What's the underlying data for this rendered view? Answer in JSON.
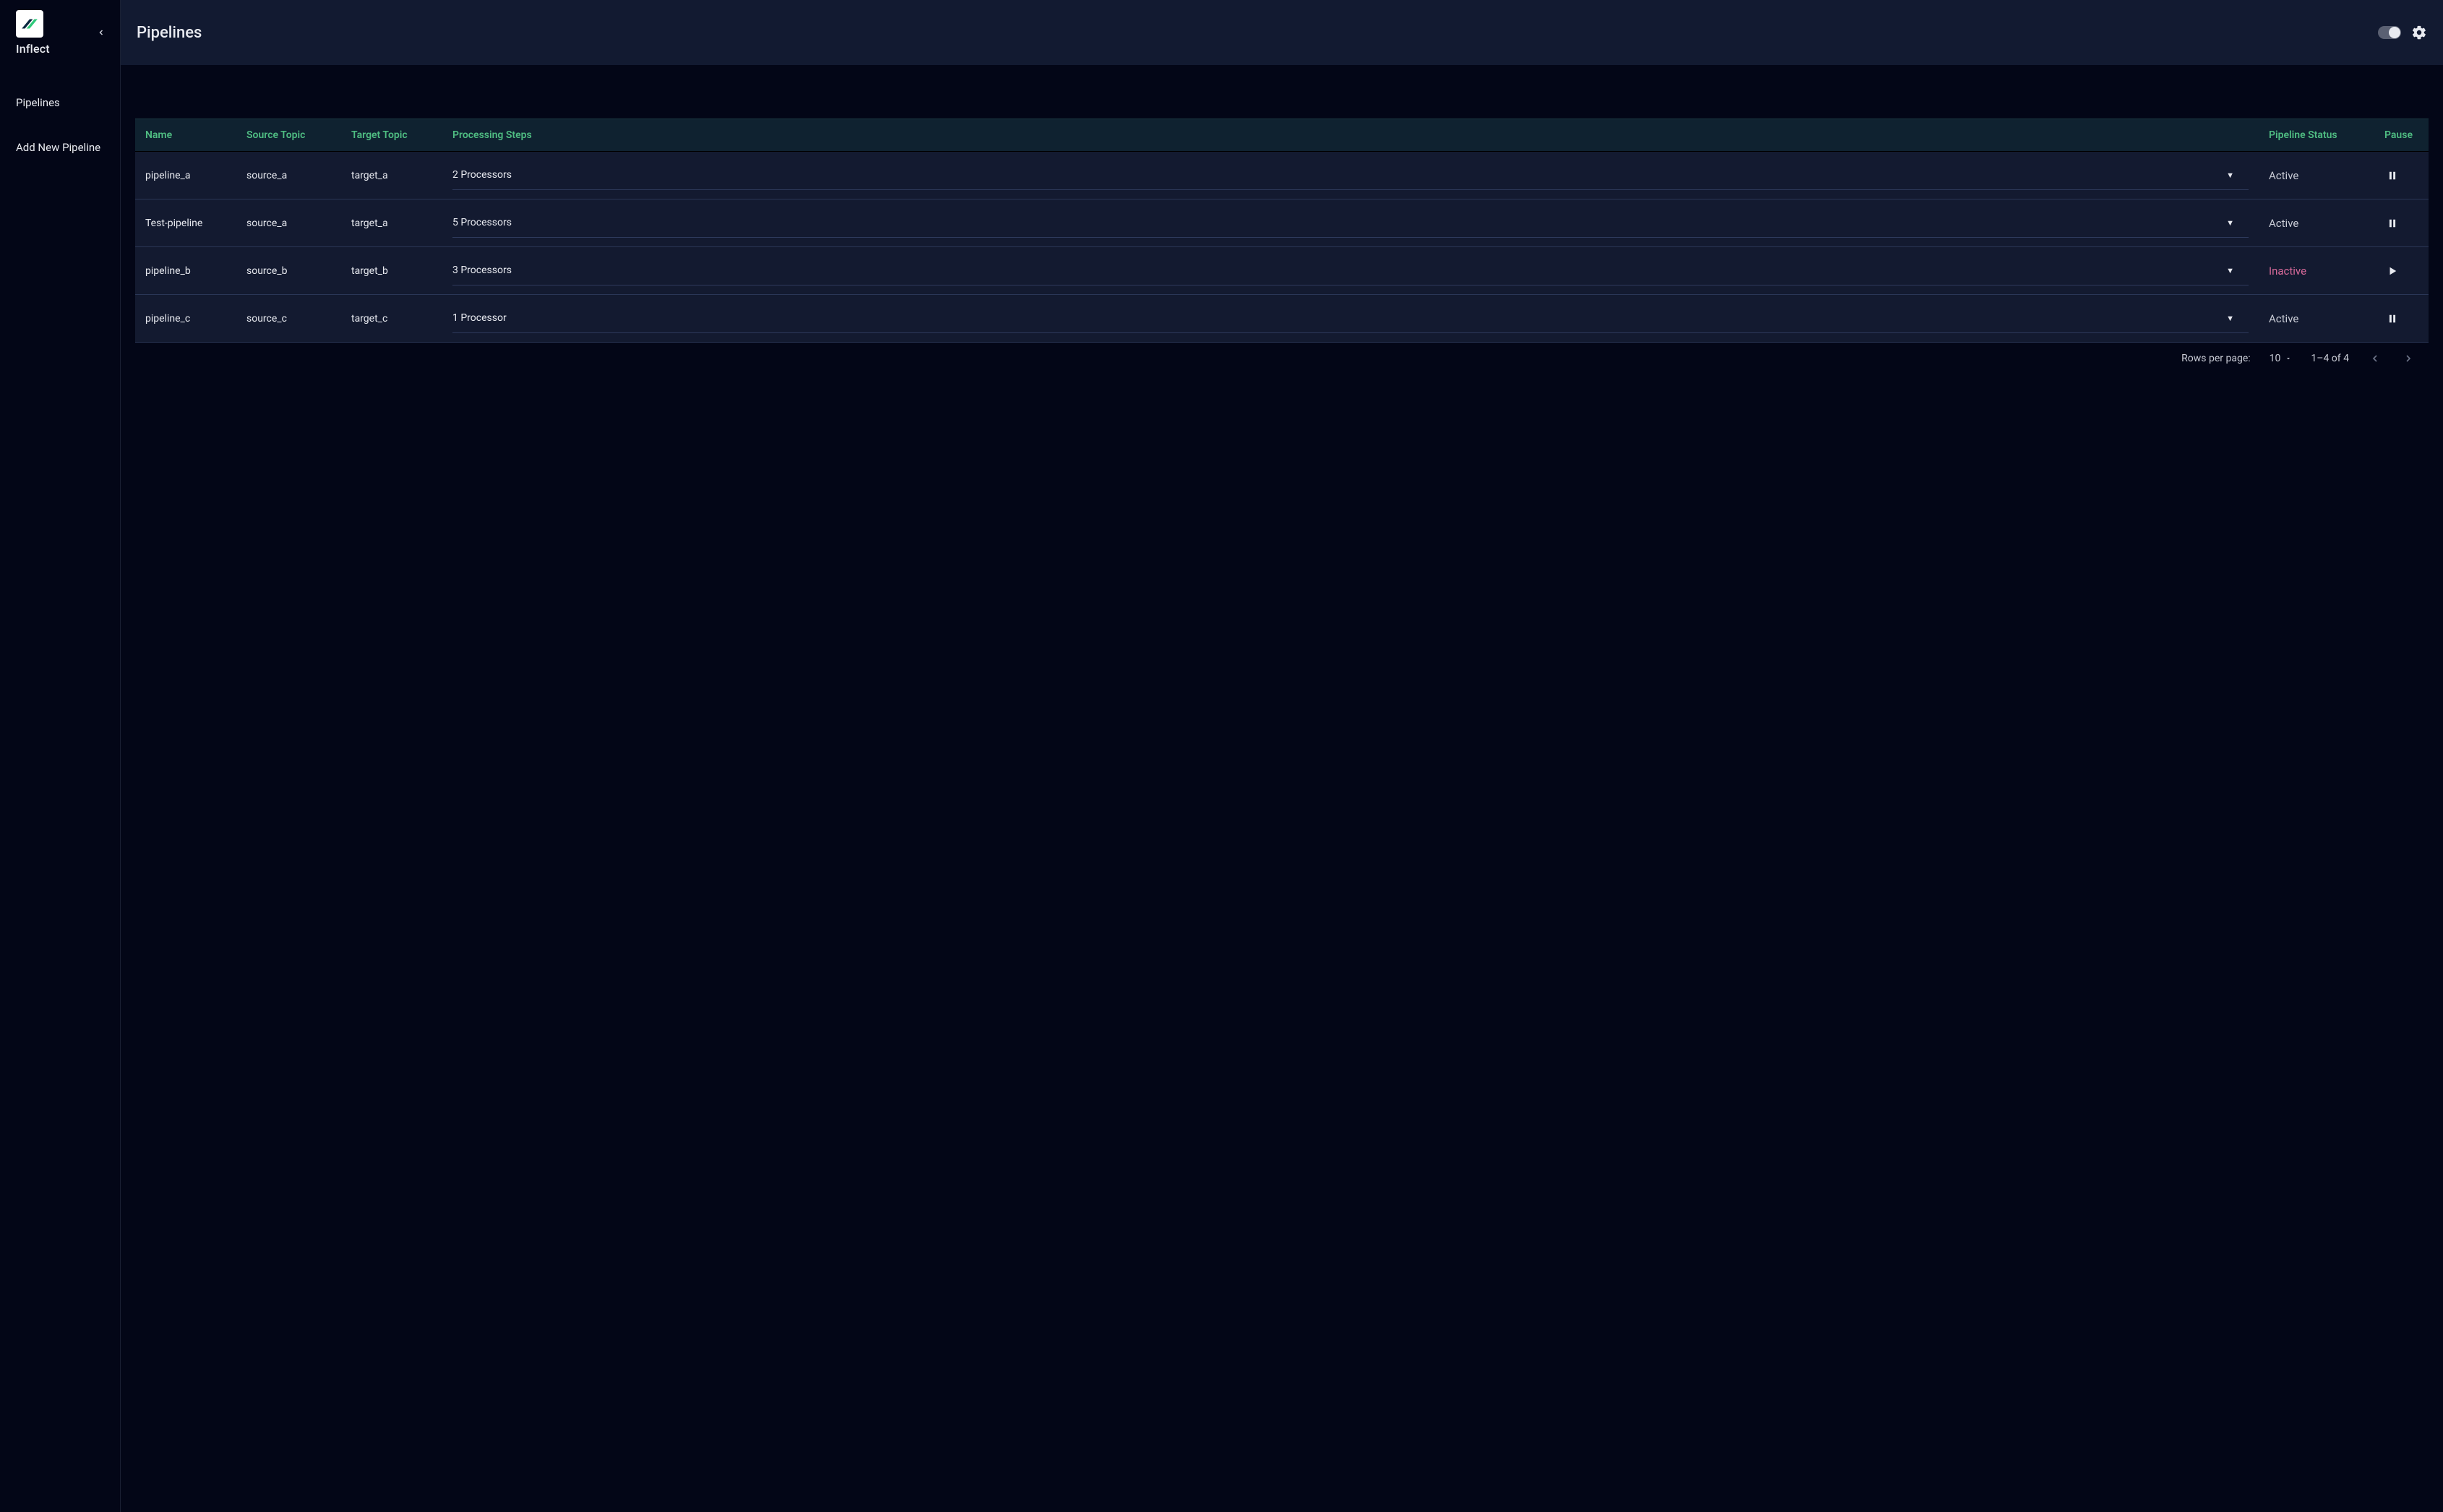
{
  "brand": {
    "name": "Inflect"
  },
  "sidebar": {
    "items": [
      {
        "label": "Pipelines"
      },
      {
        "label": "Add New Pipeline"
      }
    ]
  },
  "header": {
    "title": "Pipelines"
  },
  "table": {
    "columns": {
      "name": "Name",
      "source": "Source Topic",
      "target": "Target Topic",
      "steps": "Processing Steps",
      "status": "Pipeline Status",
      "pause": "Pause"
    },
    "rows": [
      {
        "name": "pipeline_a",
        "source": "source_a",
        "target": "target_a",
        "steps": "2 Processors",
        "status": "Active",
        "action": "pause"
      },
      {
        "name": "Test-pipeline",
        "source": "source_a",
        "target": "target_a",
        "steps": "5 Processors",
        "status": "Active",
        "action": "pause"
      },
      {
        "name": "pipeline_b",
        "source": "source_b",
        "target": "target_b",
        "steps": "3 Processors",
        "status": "Inactive",
        "action": "play"
      },
      {
        "name": "pipeline_c",
        "source": "source_c",
        "target": "target_c",
        "steps": "1 Processor",
        "status": "Active",
        "action": "pause"
      }
    ]
  },
  "pagination": {
    "rows_per_page_label": "Rows per page:",
    "rows_per_page_value": "10",
    "range_text": "1–4 of 4"
  }
}
